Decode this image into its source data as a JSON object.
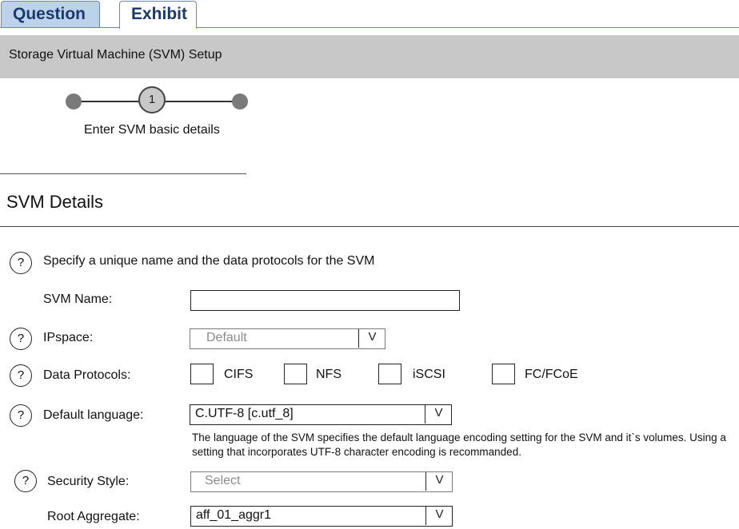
{
  "tabs": [
    {
      "label": "Question"
    },
    {
      "label": "Exhibit"
    }
  ],
  "header": {
    "title": "Storage Virtual Machine (SVM) Setup"
  },
  "stepper": {
    "current_step": "1",
    "step_label": "Enter SVM basic details"
  },
  "section": {
    "title": "SVM Details"
  },
  "form": {
    "intro": "Specify a unique name and the data protocols for the SVM",
    "svm_name": {
      "label": "SVM Name:",
      "value": ""
    },
    "ipspace": {
      "label": "IPspace:",
      "value": "Default"
    },
    "data_protocols": {
      "label": "Data Protocols:",
      "options": [
        {
          "label": "CIFS",
          "checked": false
        },
        {
          "label": "NFS",
          "checked": false
        },
        {
          "label": "iSCSI",
          "checked": false
        },
        {
          "label": "FC/FCoE",
          "checked": false
        }
      ]
    },
    "default_language": {
      "label": "Default language:",
      "value": "C.UTF-8 [c.utf_8]",
      "note": "The language of the SVM specifies the default language encoding setting for the SVM and it`s volumes. Using a setting that incorporates UTF-8 character encoding is recommanded."
    },
    "security_style": {
      "label": "Security Style:",
      "value": "Select"
    },
    "root_aggregate": {
      "label": "Root Aggregate:",
      "value": "aff_01_aggr1"
    }
  },
  "icons": {
    "help": "?",
    "dropdown": "V"
  },
  "colors": {
    "tab_active_text": "#1a3a6e",
    "tab_inactive_bg": "#bcd2ea",
    "header_band": "#c8c8c8"
  }
}
